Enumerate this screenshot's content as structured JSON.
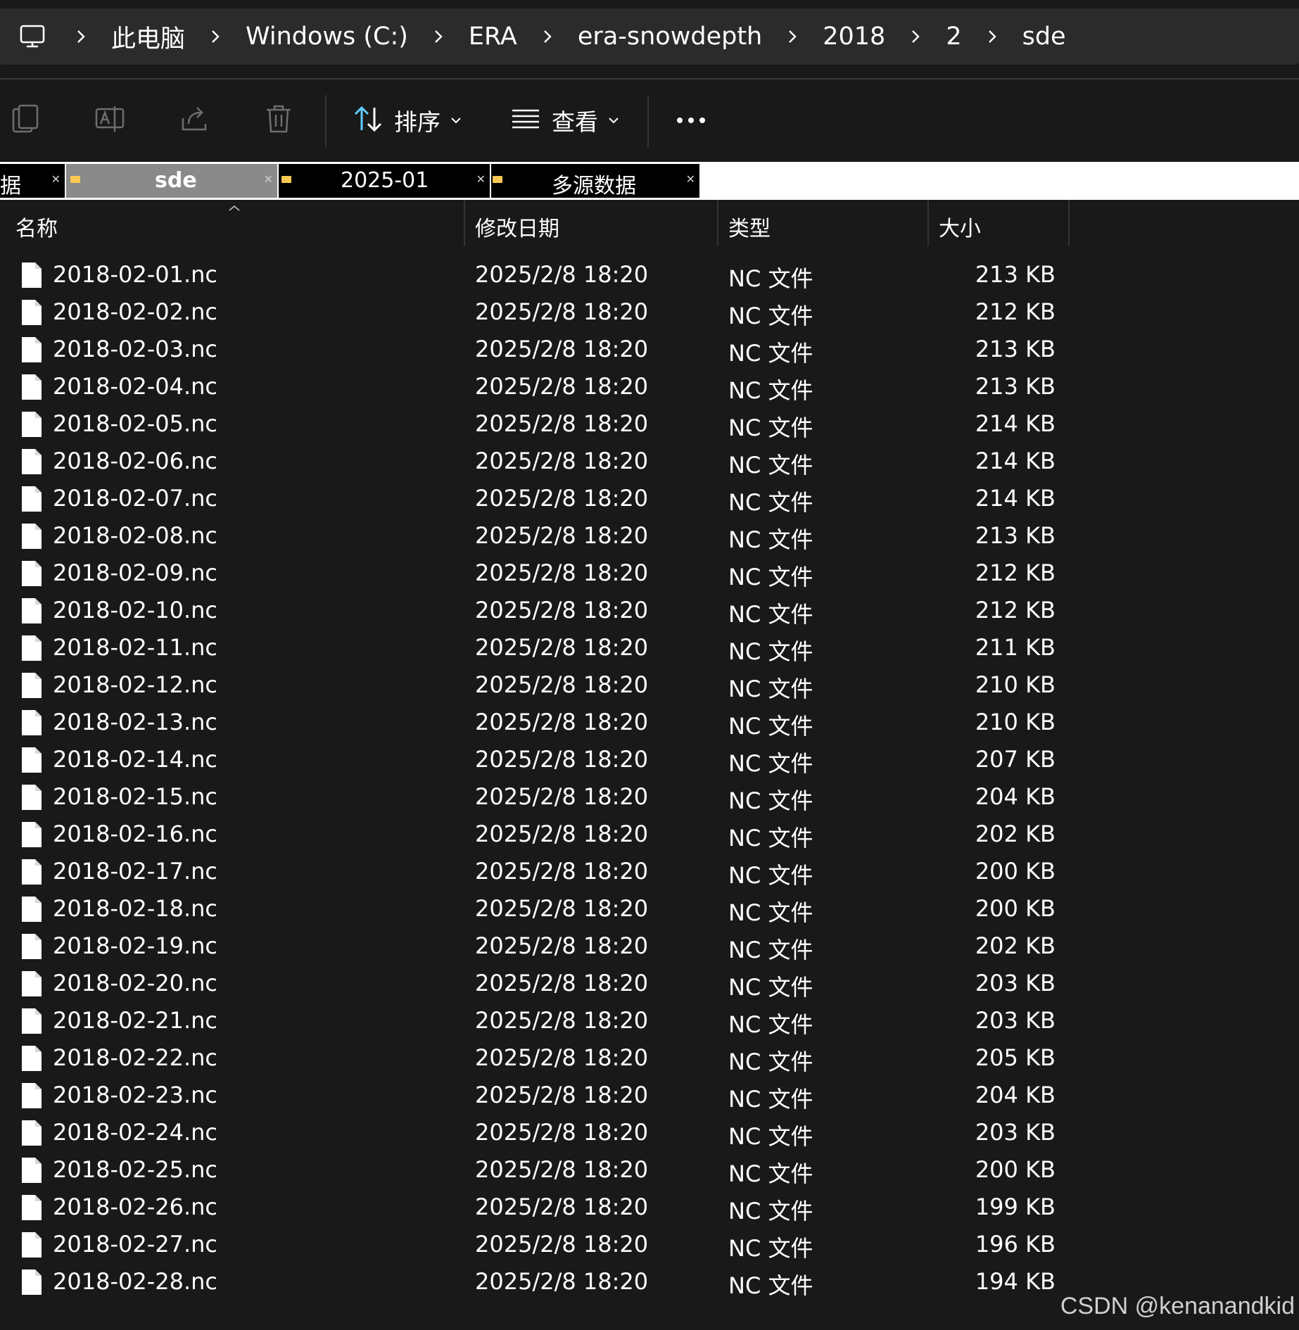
{
  "breadcrumb": {
    "items": [
      "此电脑",
      "Windows (C:)",
      "ERA",
      "era-snowdepth",
      "2018",
      "2",
      "sde"
    ]
  },
  "toolbar": {
    "sort_label": "排序",
    "view_label": "查看"
  },
  "tabs": [
    {
      "title": "据",
      "active": false
    },
    {
      "title": "sde",
      "active": true
    },
    {
      "title": "2025-01",
      "active": false
    },
    {
      "title": "多源数据",
      "active": false
    }
  ],
  "new_tab_label": "+",
  "columns": {
    "name": "名称",
    "date": "修改日期",
    "type": "类型",
    "size": "大小"
  },
  "files": [
    {
      "name": "2018-02-01.nc",
      "date": "2025/2/8 18:20",
      "type": "NC 文件",
      "size": "213 KB"
    },
    {
      "name": "2018-02-02.nc",
      "date": "2025/2/8 18:20",
      "type": "NC 文件",
      "size": "212 KB"
    },
    {
      "name": "2018-02-03.nc",
      "date": "2025/2/8 18:20",
      "type": "NC 文件",
      "size": "213 KB"
    },
    {
      "name": "2018-02-04.nc",
      "date": "2025/2/8 18:20",
      "type": "NC 文件",
      "size": "213 KB"
    },
    {
      "name": "2018-02-05.nc",
      "date": "2025/2/8 18:20",
      "type": "NC 文件",
      "size": "214 KB"
    },
    {
      "name": "2018-02-06.nc",
      "date": "2025/2/8 18:20",
      "type": "NC 文件",
      "size": "214 KB"
    },
    {
      "name": "2018-02-07.nc",
      "date": "2025/2/8 18:20",
      "type": "NC 文件",
      "size": "214 KB"
    },
    {
      "name": "2018-02-08.nc",
      "date": "2025/2/8 18:20",
      "type": "NC 文件",
      "size": "213 KB"
    },
    {
      "name": "2018-02-09.nc",
      "date": "2025/2/8 18:20",
      "type": "NC 文件",
      "size": "212 KB"
    },
    {
      "name": "2018-02-10.nc",
      "date": "2025/2/8 18:20",
      "type": "NC 文件",
      "size": "212 KB"
    },
    {
      "name": "2018-02-11.nc",
      "date": "2025/2/8 18:20",
      "type": "NC 文件",
      "size": "211 KB"
    },
    {
      "name": "2018-02-12.nc",
      "date": "2025/2/8 18:20",
      "type": "NC 文件",
      "size": "210 KB"
    },
    {
      "name": "2018-02-13.nc",
      "date": "2025/2/8 18:20",
      "type": "NC 文件",
      "size": "210 KB"
    },
    {
      "name": "2018-02-14.nc",
      "date": "2025/2/8 18:20",
      "type": "NC 文件",
      "size": "207 KB"
    },
    {
      "name": "2018-02-15.nc",
      "date": "2025/2/8 18:20",
      "type": "NC 文件",
      "size": "204 KB"
    },
    {
      "name": "2018-02-16.nc",
      "date": "2025/2/8 18:20",
      "type": "NC 文件",
      "size": "202 KB"
    },
    {
      "name": "2018-02-17.nc",
      "date": "2025/2/8 18:20",
      "type": "NC 文件",
      "size": "200 KB"
    },
    {
      "name": "2018-02-18.nc",
      "date": "2025/2/8 18:20",
      "type": "NC 文件",
      "size": "200 KB"
    },
    {
      "name": "2018-02-19.nc",
      "date": "2025/2/8 18:20",
      "type": "NC 文件",
      "size": "202 KB"
    },
    {
      "name": "2018-02-20.nc",
      "date": "2025/2/8 18:20",
      "type": "NC 文件",
      "size": "203 KB"
    },
    {
      "name": "2018-02-21.nc",
      "date": "2025/2/8 18:20",
      "type": "NC 文件",
      "size": "203 KB"
    },
    {
      "name": "2018-02-22.nc",
      "date": "2025/2/8 18:20",
      "type": "NC 文件",
      "size": "205 KB"
    },
    {
      "name": "2018-02-23.nc",
      "date": "2025/2/8 18:20",
      "type": "NC 文件",
      "size": "204 KB"
    },
    {
      "name": "2018-02-24.nc",
      "date": "2025/2/8 18:20",
      "type": "NC 文件",
      "size": "203 KB"
    },
    {
      "name": "2018-02-25.nc",
      "date": "2025/2/8 18:20",
      "type": "NC 文件",
      "size": "200 KB"
    },
    {
      "name": "2018-02-26.nc",
      "date": "2025/2/8 18:20",
      "type": "NC 文件",
      "size": "199 KB"
    },
    {
      "name": "2018-02-27.nc",
      "date": "2025/2/8 18:20",
      "type": "NC 文件",
      "size": "196 KB"
    },
    {
      "name": "2018-02-28.nc",
      "date": "2025/2/8 18:20",
      "type": "NC 文件",
      "size": "194 KB"
    }
  ],
  "watermark": "CSDN @kenanandkid",
  "colors": {
    "background": "#191919",
    "address_bar": "#2b2b2b",
    "accent_blue": "#60cdff",
    "folder_yellow": "#f8c853",
    "active_tab": "#8a8a8a"
  },
  "icons": {
    "pc": "monitor-icon",
    "separator": "chevron-right-icon",
    "copy": "copy-icon",
    "rename": "rename-icon",
    "share": "share-icon",
    "delete": "trash-icon",
    "sort": "sort-arrows-icon",
    "view": "view-list-icon",
    "more": "more-dots-icon",
    "file": "file-icon",
    "folder": "folder-icon"
  }
}
